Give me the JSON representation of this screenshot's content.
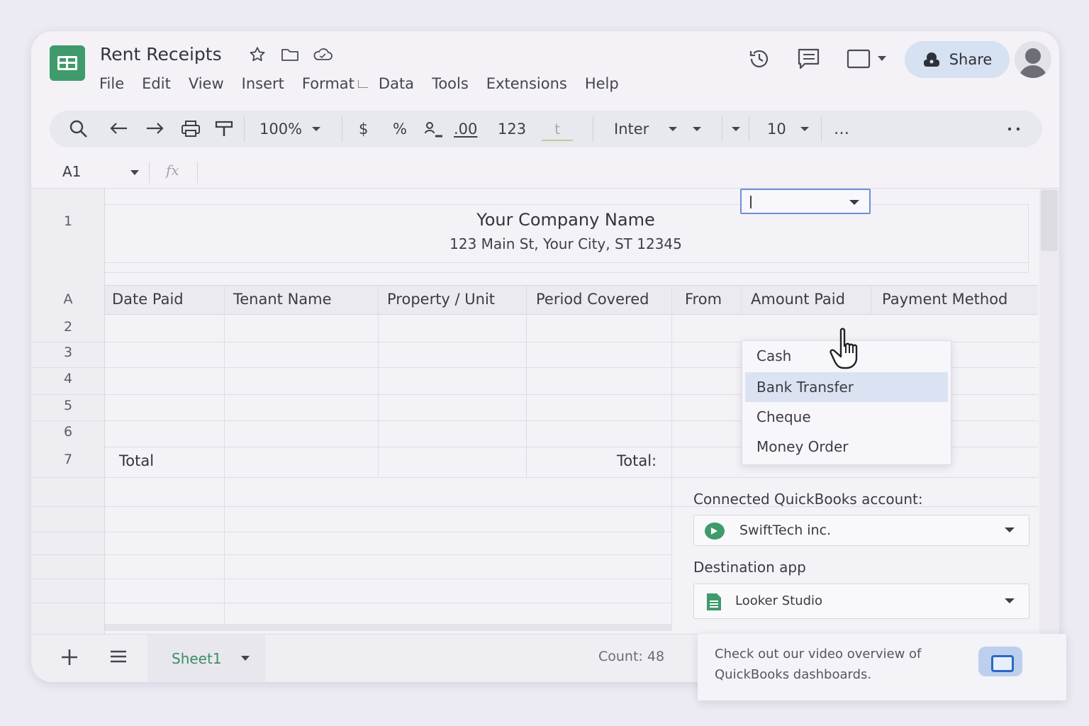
{
  "app": {
    "doc_title": "Rent Receipts",
    "menu": [
      "File",
      "Edit",
      "View",
      "Insert",
      "Format",
      "Data",
      "Tools",
      "Extensions",
      "Help"
    ],
    "share_label": "Share",
    "accent": "#3f9a6c"
  },
  "toolbar": {
    "zoom": "100%",
    "currency": "$",
    "percent": "%",
    "decimal": ".00",
    "number_format": "123",
    "font": "Inter",
    "font_size": "10",
    "more": "…"
  },
  "formula_bar": {
    "cell_ref": "A1",
    "fx": "fx"
  },
  "sheet": {
    "company_name": "Your Company Name",
    "company_address": "123 Main St, Your City, ST 12345",
    "row_labels": [
      "1",
      "A",
      "2",
      "3",
      "4",
      "5",
      "6",
      "7"
    ],
    "headers": [
      "Date Paid",
      "Tenant Name",
      "Property / Unit",
      "Period Covered",
      "From",
      "Amount Paid",
      "Payment Method"
    ],
    "total_left": "Total",
    "total_right": "Total:"
  },
  "dropdown": {
    "options": [
      "Cash",
      "Bank Transfer",
      "Cheque",
      "Money Order"
    ],
    "highlighted": "Bank Transfer"
  },
  "panel": {
    "account_label": "Connected QuickBooks account:",
    "account_value": "SwiftTech inc.",
    "destination_label": "Destination app",
    "destination_value": "Looker Studio"
  },
  "footer": {
    "sheet_tab": "Sheet1",
    "status": "Count: 48"
  },
  "toast": {
    "message": "Check out our video overview of QuickBooks dashboards."
  }
}
